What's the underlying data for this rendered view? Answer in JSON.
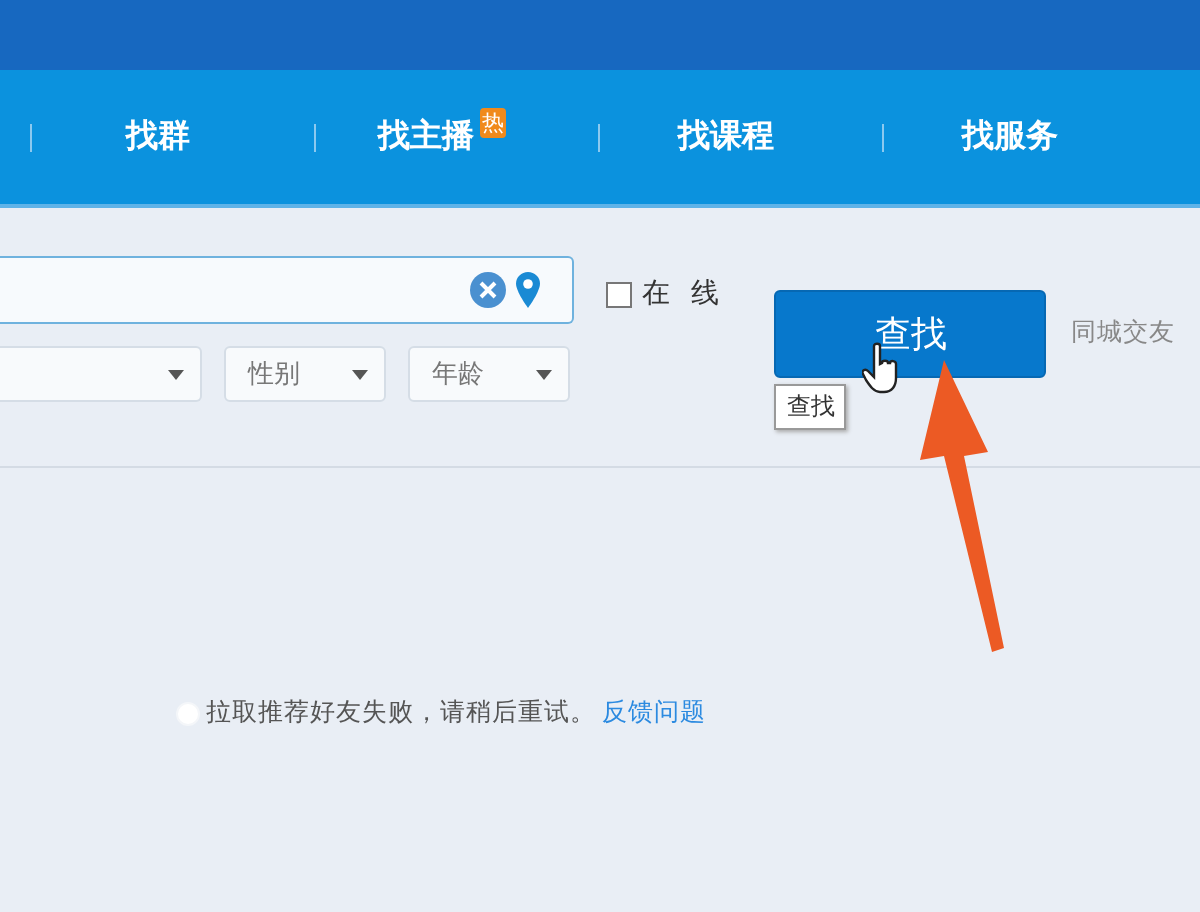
{
  "nav": [
    {
      "label": "找群"
    },
    {
      "label": "找主播",
      "badge": "热"
    },
    {
      "label": "找课程"
    },
    {
      "label": "找服务"
    }
  ],
  "search": {
    "online": {
      "label": "在 线",
      "checked": false
    },
    "filters": [
      {
        "kind": "wide"
      },
      {
        "kind": "narrow",
        "label": "性别"
      },
      {
        "kind": "narrow",
        "label": "年龄"
      }
    ],
    "button": "查找",
    "tooltip": "查找",
    "side_link": "同城交友"
  },
  "message": {
    "text": "拉取推荐好友失败，请稍后重试。",
    "link": "反馈问题"
  }
}
